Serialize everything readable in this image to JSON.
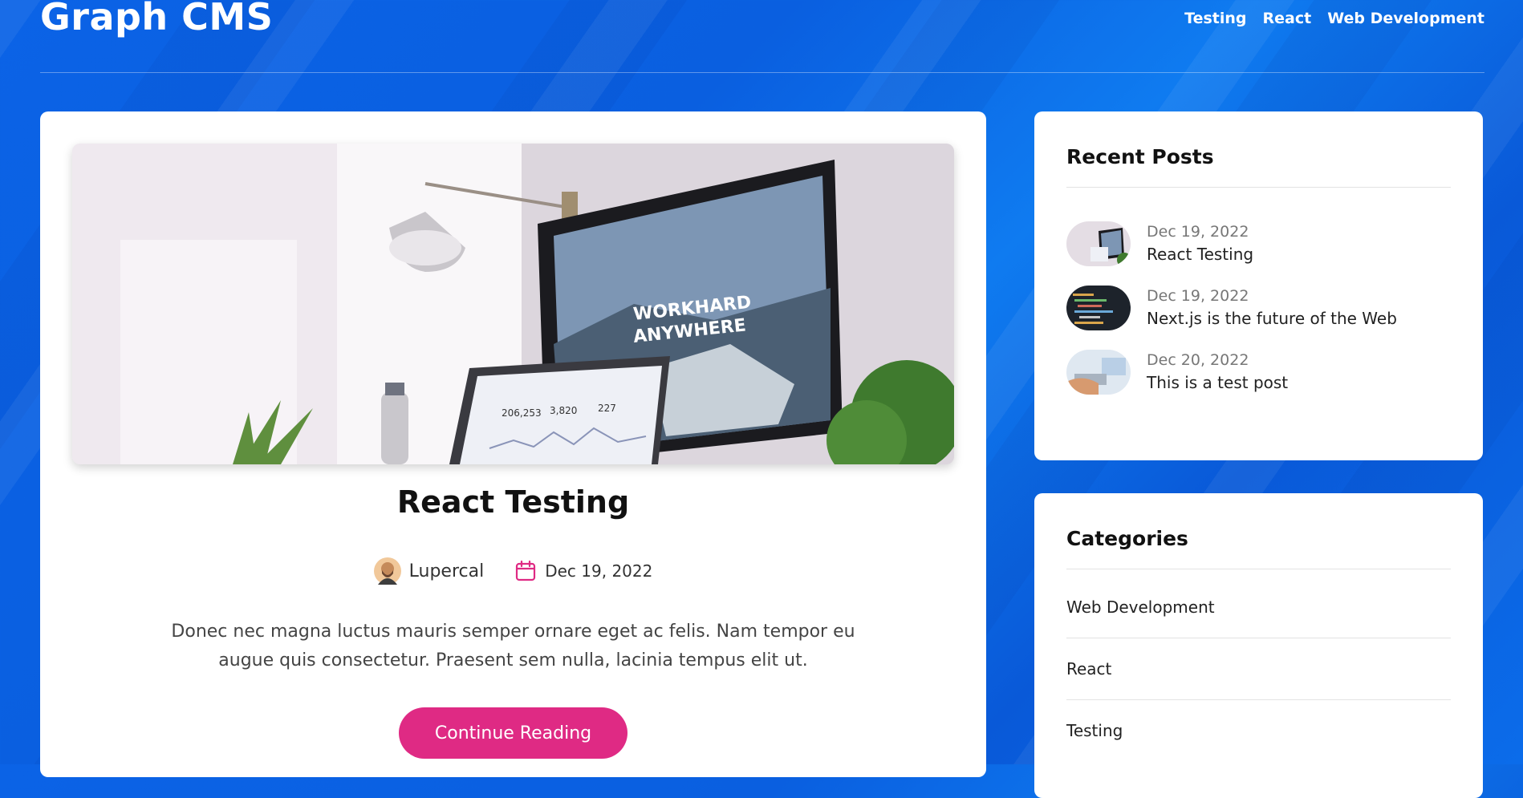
{
  "header": {
    "brand": "Graph CMS",
    "nav": [
      "Testing",
      "React",
      "Web Development"
    ]
  },
  "post": {
    "title": "React Testing",
    "author": "Lupercal",
    "date": "Dec 19, 2022",
    "excerpt": "Donec nec magna luctus mauris semper ornare eget ac felis. Nam tempor eu augue quis consectetur. Praesent sem nulla, lacinia tempus elit ut.",
    "cta_label": "Continue Reading",
    "hero_screen_text": [
      "WORKHARD",
      "ANYWHERE"
    ],
    "laptop_stats": [
      "206,253",
      "3,820",
      "227"
    ]
  },
  "recent_posts": {
    "title": "Recent Posts",
    "items": [
      {
        "date": "Dec 19, 2022",
        "title": "React Testing"
      },
      {
        "date": "Dec 19, 2022",
        "title": "Next.js is the future of the Web"
      },
      {
        "date": "Dec 20, 2022",
        "title": "This is a test post"
      }
    ]
  },
  "categories": {
    "title": "Categories",
    "items": [
      "Web Development",
      "React",
      "Testing"
    ]
  },
  "colors": {
    "accent": "#df2a84",
    "background": "#0b63e6"
  }
}
